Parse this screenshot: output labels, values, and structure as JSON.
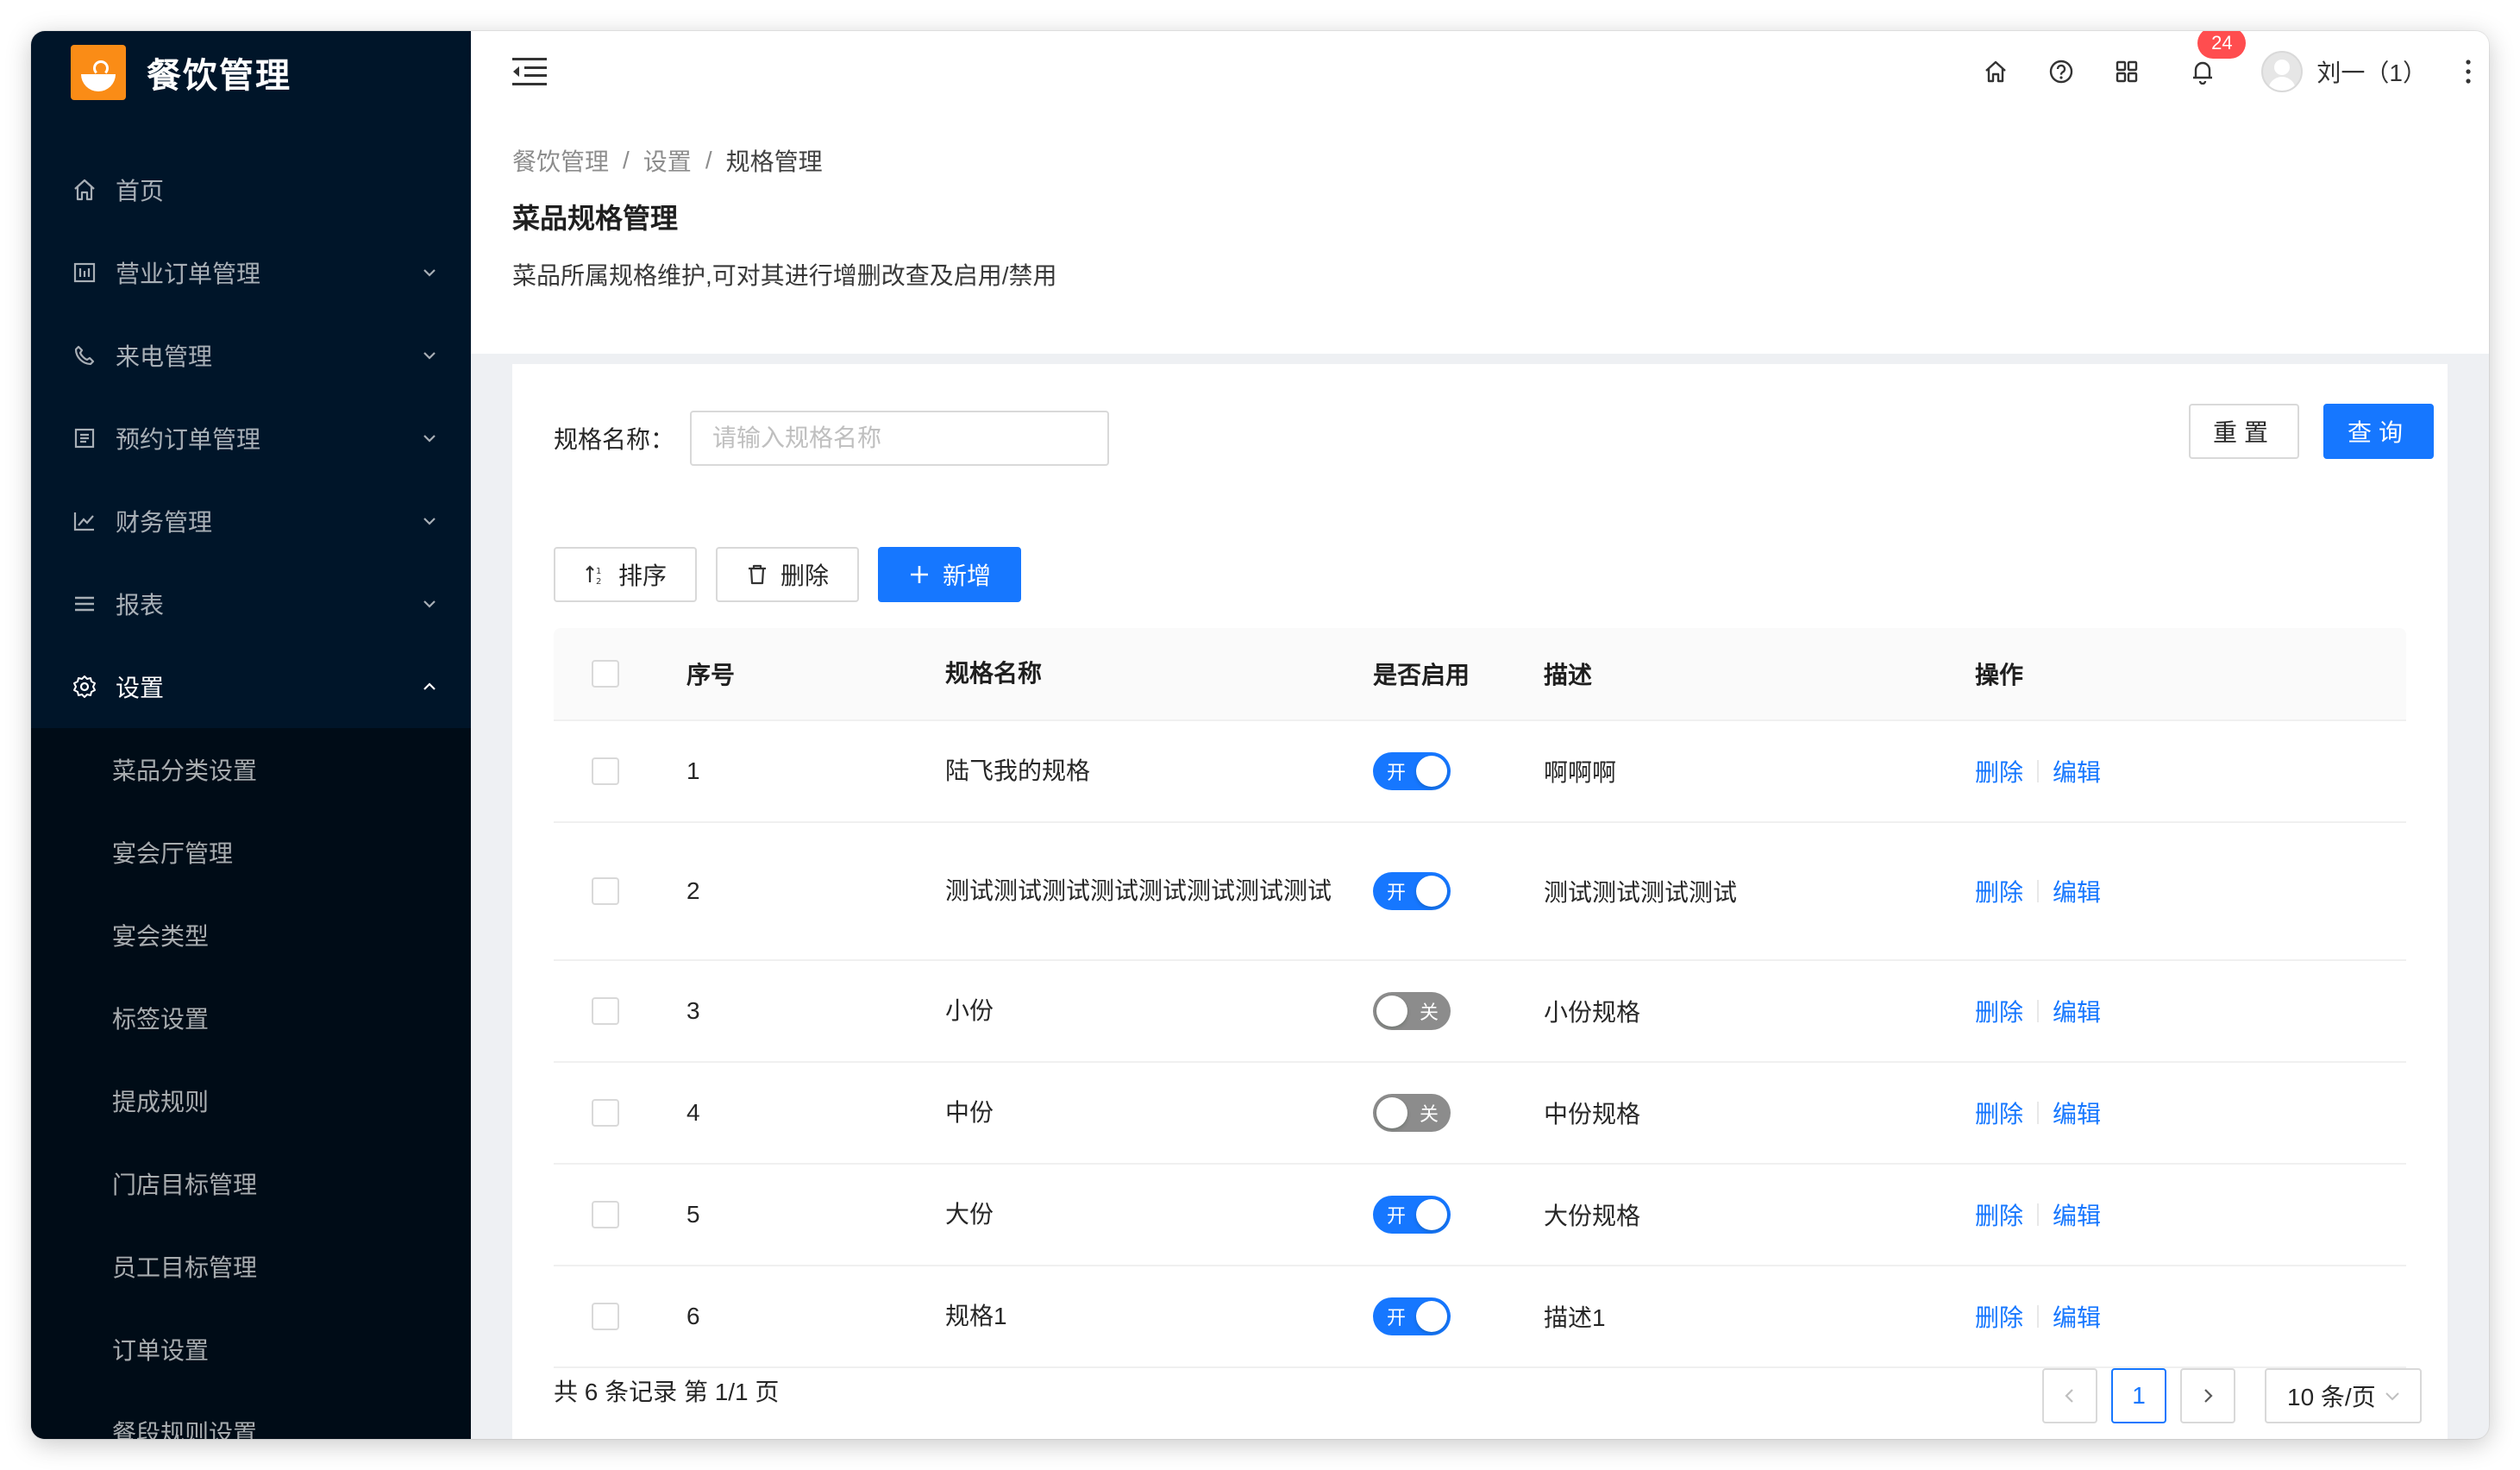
{
  "app": {
    "title": "餐饮管理"
  },
  "sidebar": {
    "items": [
      {
        "label": "首页",
        "icon": "home-icon"
      },
      {
        "label": "营业订单管理",
        "icon": "order-icon",
        "has_arrow": true
      },
      {
        "label": "来电管理",
        "icon": "phone-icon",
        "has_arrow": true
      },
      {
        "label": "预约订单管理",
        "icon": "reservation-icon",
        "has_arrow": true
      },
      {
        "label": "财务管理",
        "icon": "finance-icon",
        "has_arrow": true
      },
      {
        "label": "报表",
        "icon": "report-icon",
        "has_arrow": true
      },
      {
        "label": "设置",
        "icon": "settings-icon",
        "has_arrow": true,
        "open": true
      }
    ],
    "settings_children": [
      "菜品分类设置",
      "宴会厅管理",
      "宴会类型",
      "标签设置",
      "提成规则",
      "门店目标管理",
      "员工目标管理",
      "订单设置",
      "餐段规则设置"
    ]
  },
  "header": {
    "notification_count": "24",
    "username": "刘一（1）"
  },
  "breadcrumb": [
    "餐饮管理",
    "设置",
    "规格管理"
  ],
  "page": {
    "title": "菜品规格管理",
    "description": "菜品所属规格维护,可对其进行增删改查及启用/禁用"
  },
  "search": {
    "label": "规格名称：",
    "placeholder": "请输入规格名称",
    "value": "",
    "reset_label": "重置",
    "query_label": "查询"
  },
  "toolbar": {
    "sort_label": "排序",
    "delete_label": "删除",
    "add_label": "新增"
  },
  "table": {
    "columns": [
      "序号",
      "规格名称",
      "是否启用",
      "描述",
      "操作"
    ],
    "rows": [
      {
        "index": "1",
        "name": "陆飞我的规格",
        "enabled": true,
        "enabled_text": "开",
        "description": "啊啊啊",
        "delete": "删除",
        "edit": "编辑"
      },
      {
        "index": "2",
        "name": "测试测试测试测试测试测试测试测试",
        "enabled": true,
        "enabled_text": "开",
        "description": "测试测试测试测试",
        "delete": "删除",
        "edit": "编辑"
      },
      {
        "index": "3",
        "name": "小份",
        "enabled": false,
        "enabled_text": "关",
        "description": "小份规格",
        "delete": "删除",
        "edit": "编辑"
      },
      {
        "index": "4",
        "name": "中份",
        "enabled": false,
        "enabled_text": "关",
        "description": "中份规格",
        "delete": "删除",
        "edit": "编辑"
      },
      {
        "index": "5",
        "name": "大份",
        "enabled": true,
        "enabled_text": "开",
        "description": "大份规格",
        "delete": "删除",
        "edit": "编辑"
      },
      {
        "index": "6",
        "name": "规格1",
        "enabled": true,
        "enabled_text": "开",
        "description": "描述1",
        "delete": "删除",
        "edit": "编辑"
      }
    ]
  },
  "pagination": {
    "summary": "共 6 条记录 第 1/1 页",
    "current_page": "1",
    "page_size": "10 条/页"
  },
  "colors": {
    "sidebar_bg": "#001529",
    "submenu_bg": "#000c17",
    "primary": "#1677ff",
    "brand_orange": "#fa8c16",
    "badge_red": "#ff4d4f"
  }
}
